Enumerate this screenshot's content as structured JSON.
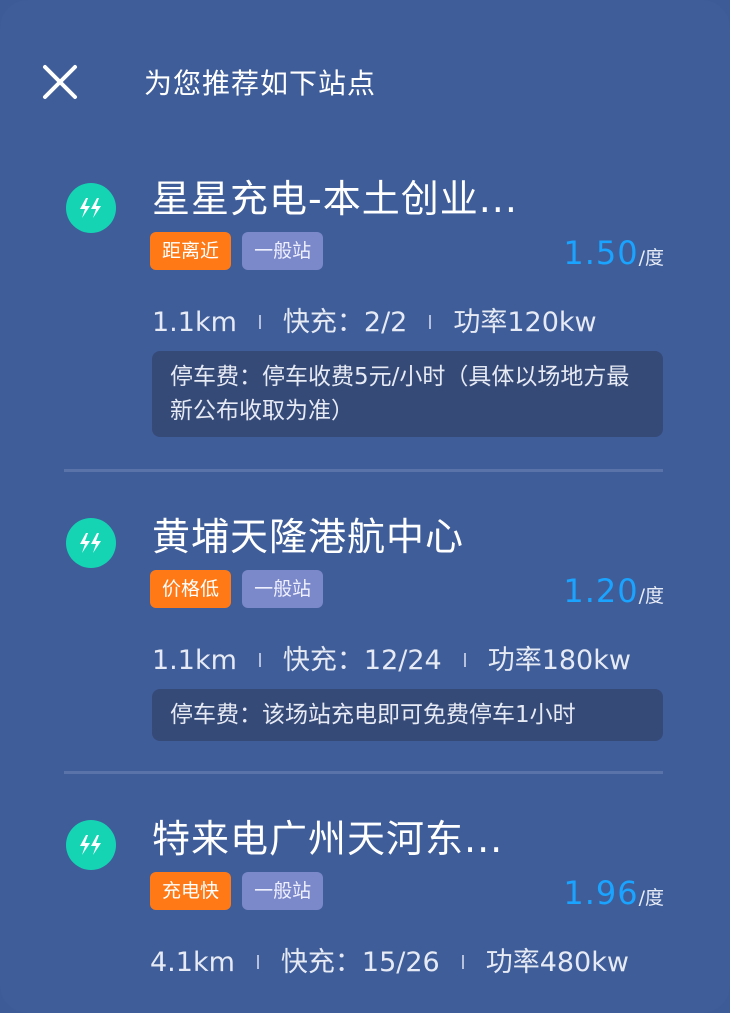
{
  "header": {
    "title": "为您推荐如下站点"
  },
  "stations": [
    {
      "name": "星星充电-本土创业...",
      "hot_tag": "距离近",
      "type_tag": "一般站",
      "price": "1.50",
      "price_unit": "/度",
      "distance": "1.1km",
      "fast_charge": "快充：2/2",
      "power": "功率120kw",
      "parking": "停车费：停车收费5元/小时（具体以场地方最新公布收取为准）"
    },
    {
      "name": "黄埔天隆港航中心",
      "hot_tag": "价格低",
      "type_tag": "一般站",
      "price": "1.20",
      "price_unit": "/度",
      "distance": "1.1km",
      "fast_charge": "快充：12/24",
      "power": "功率180kw",
      "parking": "停车费：该场站充电即可免费停车1小时"
    },
    {
      "name": "特来电广州天河东...",
      "hot_tag": "充电快",
      "type_tag": "一般站",
      "price": "1.96",
      "price_unit": "/度",
      "distance": "4.1km",
      "fast_charge": "快充：15/26",
      "power": "功率480kw"
    }
  ],
  "colors": {
    "background": "#3f5d99",
    "accent_price": "#1aa3ff",
    "tag_hot": "#ff7a16",
    "tag_type": "#7b88c9",
    "bolt_icon_bg": "#15d4b4"
  }
}
